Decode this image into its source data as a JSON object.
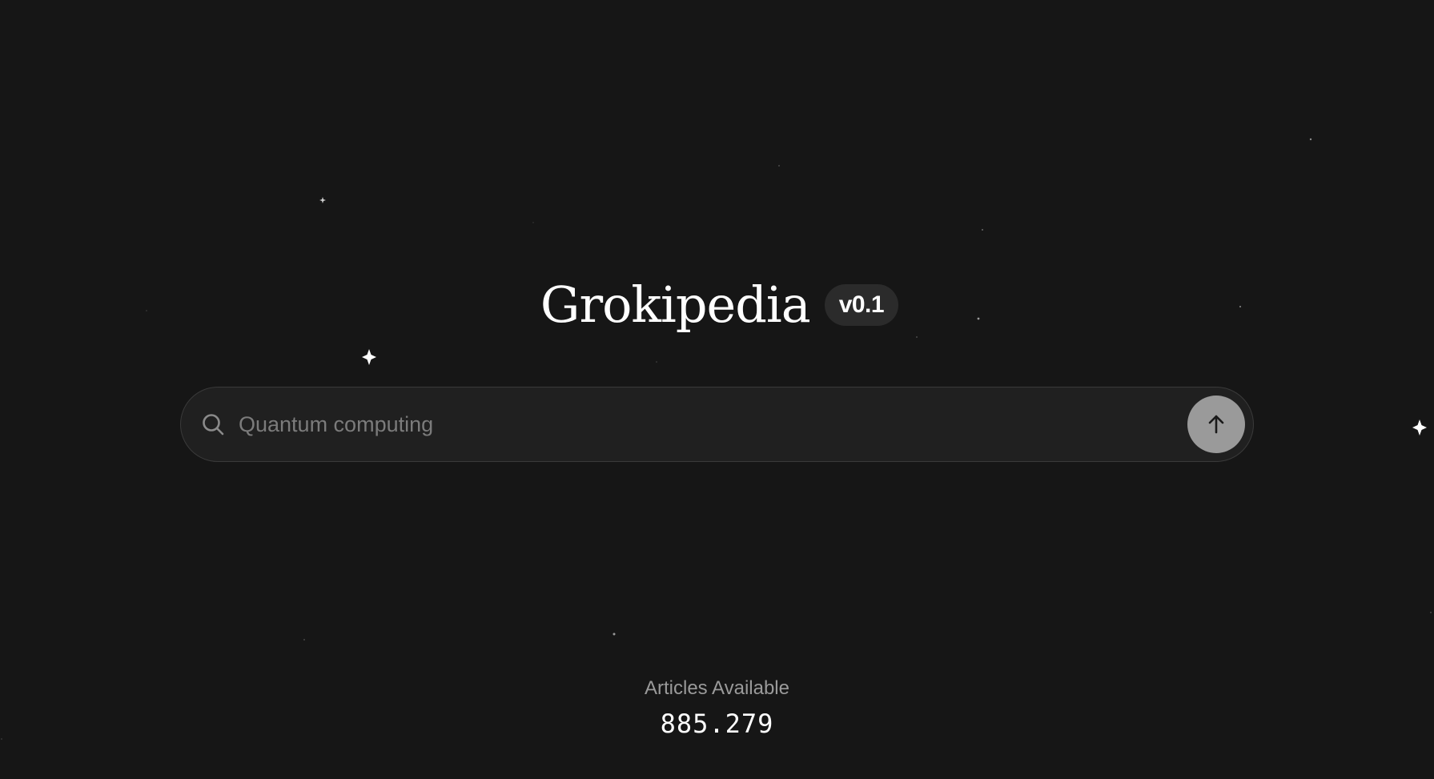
{
  "header": {
    "title": "Grokipedia",
    "version": "v0.1"
  },
  "search": {
    "placeholder": "Quantum computing",
    "value": "",
    "search_icon": "search-icon",
    "submit_icon": "arrow-up-icon"
  },
  "stats": {
    "label": "Articles Available",
    "value": "885.279"
  },
  "colors": {
    "background": "#161616",
    "search_bg": "#202020",
    "submit_button": "#9a9a9a",
    "badge_bg": "#2b2b2b"
  }
}
